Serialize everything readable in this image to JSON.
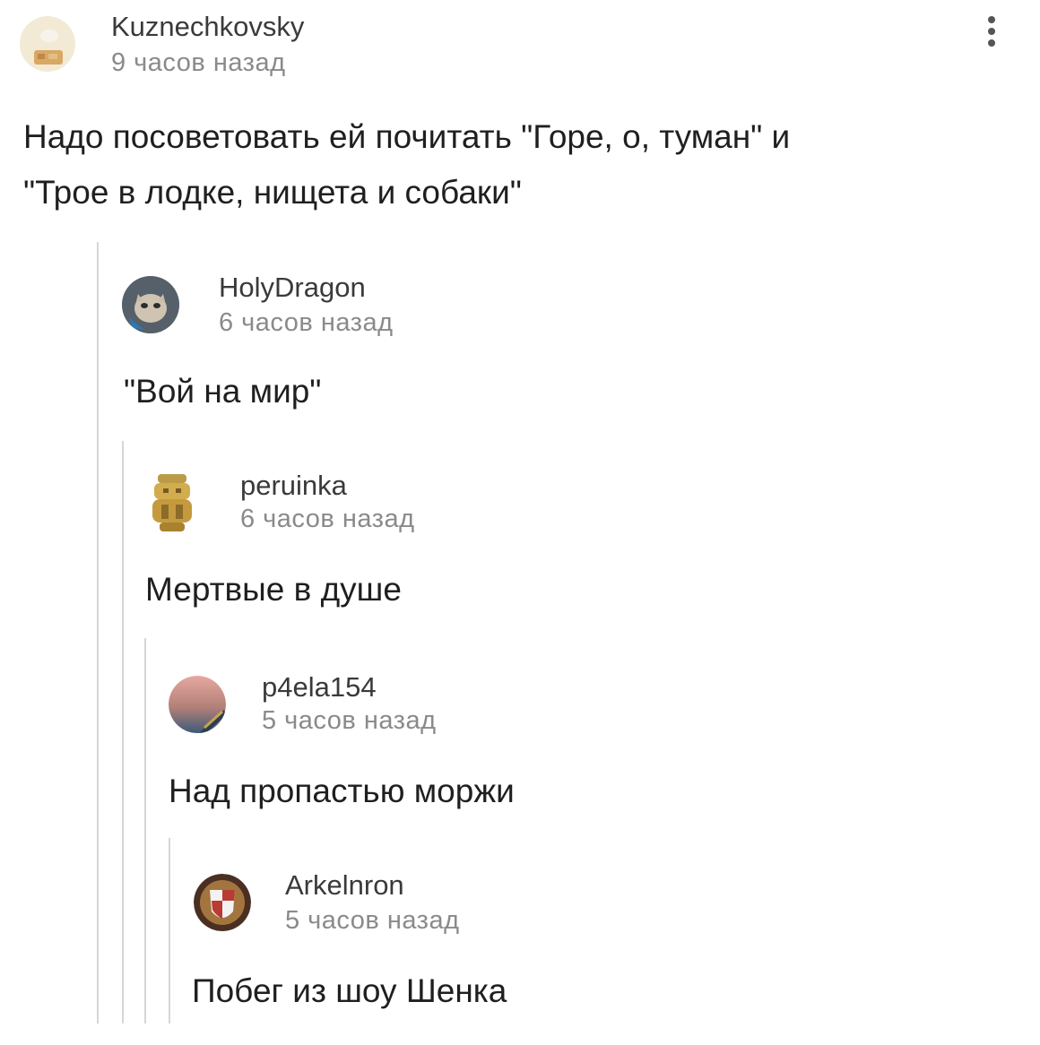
{
  "comments": [
    {
      "username": "Kuznechkovsky",
      "time": "9 часов назад",
      "text_lines": [
        "Надо посоветовать ей почитать \"Горе, о, туман\" и",
        "\"Трое в лодке, нищета и собаки\""
      ]
    },
    {
      "username": "HolyDragon",
      "time": "6 часов назад",
      "text": "\"Вой на мир\""
    },
    {
      "username": "peruinka",
      "time": "6 часов назад",
      "text": "Мертвые в душе"
    },
    {
      "username": "p4ela154",
      "time": "5 часов назад",
      "text": "Над пропастью моржи"
    },
    {
      "username": "Arkelnron",
      "time": "5 часов назад",
      "text": "Побег из шоу Шенка"
    }
  ],
  "icons": {
    "menu": "more-vertical-icon",
    "avatar_1": "chef-avatar",
    "avatar_2": "cat-avatar",
    "avatar_3": "aztec-statue-avatar",
    "avatar_4": "gradient-avatar",
    "avatar_5": "shield-avatar"
  }
}
